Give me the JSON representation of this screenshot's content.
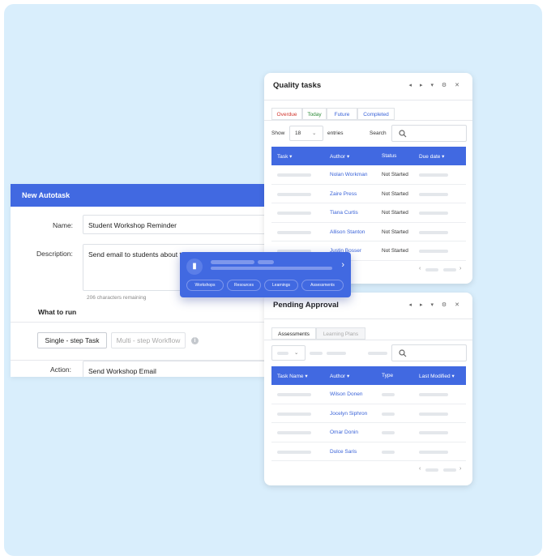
{
  "autotask": {
    "title": "New Autotask",
    "name_label": "Name:",
    "name_value": "Student Workshop Reminder",
    "description_label": "Description:",
    "description_value": "Send email to students about t",
    "chars_remaining": "206 characters remaining",
    "what_to_run_label": "What to run",
    "single_step_label": "Single - step Task",
    "multi_step_label": "Multi - step Workflow",
    "info_icon": "i",
    "action_label": "Action:",
    "action_value": "Send Workshop Email"
  },
  "popup": {
    "icon": "bookmark-icon",
    "chevron": "›",
    "chips": [
      "Workshops",
      "Resources",
      "Learnings",
      "Assessments"
    ]
  },
  "quality": {
    "title": "Quality tasks",
    "tools": "◂ ▸ ▾ ⚙ ✕",
    "tabs": [
      "Overdue",
      "Today",
      "Future",
      "Completed"
    ],
    "tab_colors": [
      "#d0342c",
      "#2e8b3a",
      "#3a63d8",
      "#3a63d8"
    ],
    "show_label": "Show",
    "show_value": "18",
    "entries_label": "entries",
    "search_label": "Search",
    "headers": [
      "Task ▾",
      "Author ▾",
      "Status",
      "Due date ▾"
    ],
    "rows": [
      {
        "author": "Nolan Workman",
        "status": "Not Started"
      },
      {
        "author": "Zaire Press",
        "status": "Not Started"
      },
      {
        "author": "Tiana Curtis",
        "status": "Not Started"
      },
      {
        "author": "Allison Stanton",
        "status": "Not Started"
      },
      {
        "author": "Justin Bosser",
        "status": "Not Started"
      }
    ],
    "pager_prev": "‹",
    "pager_next": "›"
  },
  "pending": {
    "title": "Pending Approval",
    "tools": "◂ ▸ ▾ ⚙ ✕",
    "tabs": [
      "Assessments",
      "Learning Plans"
    ],
    "headers": [
      "Task Name ▾",
      "Author ▾",
      "Type",
      "Last Modified ▾"
    ],
    "rows": [
      {
        "author": "Wilson Donen"
      },
      {
        "author": "Jocelyn Siphron"
      },
      {
        "author": "Omar Donin"
      },
      {
        "author": "Dulce Saris"
      }
    ],
    "pager_prev": "‹",
    "pager_next": "›"
  }
}
